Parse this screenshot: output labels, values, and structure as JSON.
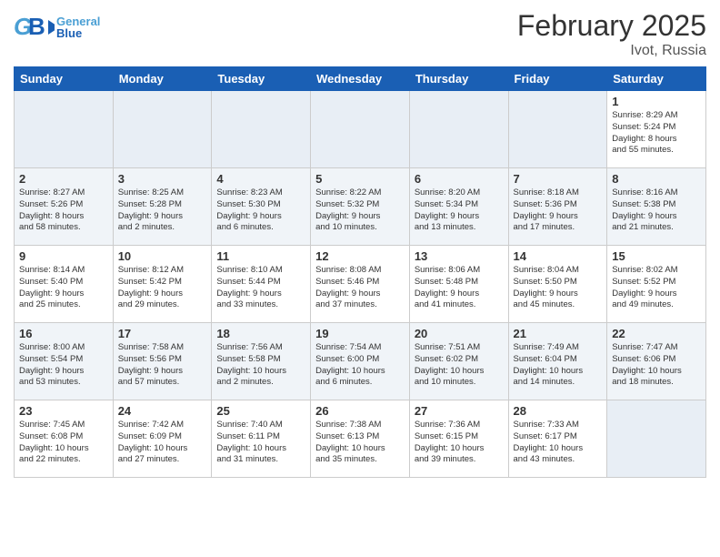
{
  "header": {
    "logo_general": "General",
    "logo_blue": "Blue",
    "title": "February 2025",
    "subtitle": "Ivot, Russia"
  },
  "weekdays": [
    "Sunday",
    "Monday",
    "Tuesday",
    "Wednesday",
    "Thursday",
    "Friday",
    "Saturday"
  ],
  "weeks": [
    {
      "days": [
        {
          "num": "",
          "info": ""
        },
        {
          "num": "",
          "info": ""
        },
        {
          "num": "",
          "info": ""
        },
        {
          "num": "",
          "info": ""
        },
        {
          "num": "",
          "info": ""
        },
        {
          "num": "",
          "info": ""
        },
        {
          "num": "1",
          "info": "Sunrise: 8:29 AM\nSunset: 5:24 PM\nDaylight: 8 hours\nand 55 minutes."
        }
      ]
    },
    {
      "days": [
        {
          "num": "2",
          "info": "Sunrise: 8:27 AM\nSunset: 5:26 PM\nDaylight: 8 hours\nand 58 minutes."
        },
        {
          "num": "3",
          "info": "Sunrise: 8:25 AM\nSunset: 5:28 PM\nDaylight: 9 hours\nand 2 minutes."
        },
        {
          "num": "4",
          "info": "Sunrise: 8:23 AM\nSunset: 5:30 PM\nDaylight: 9 hours\nand 6 minutes."
        },
        {
          "num": "5",
          "info": "Sunrise: 8:22 AM\nSunset: 5:32 PM\nDaylight: 9 hours\nand 10 minutes."
        },
        {
          "num": "6",
          "info": "Sunrise: 8:20 AM\nSunset: 5:34 PM\nDaylight: 9 hours\nand 13 minutes."
        },
        {
          "num": "7",
          "info": "Sunrise: 8:18 AM\nSunset: 5:36 PM\nDaylight: 9 hours\nand 17 minutes."
        },
        {
          "num": "8",
          "info": "Sunrise: 8:16 AM\nSunset: 5:38 PM\nDaylight: 9 hours\nand 21 minutes."
        }
      ]
    },
    {
      "days": [
        {
          "num": "9",
          "info": "Sunrise: 8:14 AM\nSunset: 5:40 PM\nDaylight: 9 hours\nand 25 minutes."
        },
        {
          "num": "10",
          "info": "Sunrise: 8:12 AM\nSunset: 5:42 PM\nDaylight: 9 hours\nand 29 minutes."
        },
        {
          "num": "11",
          "info": "Sunrise: 8:10 AM\nSunset: 5:44 PM\nDaylight: 9 hours\nand 33 minutes."
        },
        {
          "num": "12",
          "info": "Sunrise: 8:08 AM\nSunset: 5:46 PM\nDaylight: 9 hours\nand 37 minutes."
        },
        {
          "num": "13",
          "info": "Sunrise: 8:06 AM\nSunset: 5:48 PM\nDaylight: 9 hours\nand 41 minutes."
        },
        {
          "num": "14",
          "info": "Sunrise: 8:04 AM\nSunset: 5:50 PM\nDaylight: 9 hours\nand 45 minutes."
        },
        {
          "num": "15",
          "info": "Sunrise: 8:02 AM\nSunset: 5:52 PM\nDaylight: 9 hours\nand 49 minutes."
        }
      ]
    },
    {
      "days": [
        {
          "num": "16",
          "info": "Sunrise: 8:00 AM\nSunset: 5:54 PM\nDaylight: 9 hours\nand 53 minutes."
        },
        {
          "num": "17",
          "info": "Sunrise: 7:58 AM\nSunset: 5:56 PM\nDaylight: 9 hours\nand 57 minutes."
        },
        {
          "num": "18",
          "info": "Sunrise: 7:56 AM\nSunset: 5:58 PM\nDaylight: 10 hours\nand 2 minutes."
        },
        {
          "num": "19",
          "info": "Sunrise: 7:54 AM\nSunset: 6:00 PM\nDaylight: 10 hours\nand 6 minutes."
        },
        {
          "num": "20",
          "info": "Sunrise: 7:51 AM\nSunset: 6:02 PM\nDaylight: 10 hours\nand 10 minutes."
        },
        {
          "num": "21",
          "info": "Sunrise: 7:49 AM\nSunset: 6:04 PM\nDaylight: 10 hours\nand 14 minutes."
        },
        {
          "num": "22",
          "info": "Sunrise: 7:47 AM\nSunset: 6:06 PM\nDaylight: 10 hours\nand 18 minutes."
        }
      ]
    },
    {
      "days": [
        {
          "num": "23",
          "info": "Sunrise: 7:45 AM\nSunset: 6:08 PM\nDaylight: 10 hours\nand 22 minutes."
        },
        {
          "num": "24",
          "info": "Sunrise: 7:42 AM\nSunset: 6:09 PM\nDaylight: 10 hours\nand 27 minutes."
        },
        {
          "num": "25",
          "info": "Sunrise: 7:40 AM\nSunset: 6:11 PM\nDaylight: 10 hours\nand 31 minutes."
        },
        {
          "num": "26",
          "info": "Sunrise: 7:38 AM\nSunset: 6:13 PM\nDaylight: 10 hours\nand 35 minutes."
        },
        {
          "num": "27",
          "info": "Sunrise: 7:36 AM\nSunset: 6:15 PM\nDaylight: 10 hours\nand 39 minutes."
        },
        {
          "num": "28",
          "info": "Sunrise: 7:33 AM\nSunset: 6:17 PM\nDaylight: 10 hours\nand 43 minutes."
        },
        {
          "num": "",
          "info": ""
        }
      ]
    }
  ],
  "colors": {
    "header_bg": "#1a5fb4",
    "even_row": "#f0f4f8",
    "odd_row": "#ffffff",
    "empty_cell": "#e8eef5"
  }
}
